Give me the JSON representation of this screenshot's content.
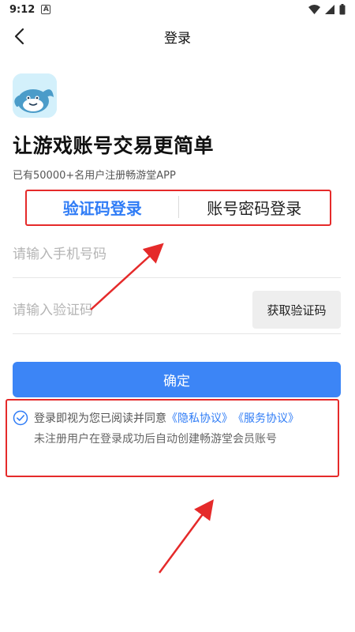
{
  "status_bar": {
    "time": "9:12",
    "notification": "A"
  },
  "nav": {
    "title": "登录"
  },
  "headline": "让游戏账号交易更简单",
  "subtext": "已有50000+名用户注册畅游堂APP",
  "tabs": {
    "sms_login": "验证码登录",
    "password_login": "账号密码登录"
  },
  "form": {
    "phone_placeholder": "请输入手机号码",
    "code_placeholder": "请输入验证码",
    "get_code_label": "获取验证码",
    "confirm_label": "确定"
  },
  "agreement": {
    "prefix": "登录即视为您已阅读并同意",
    "privacy_link": "《隐私协议》",
    "service_link": "《服务协议》",
    "note": "未注册用户在登录成功后自动创建畅游堂会员账号"
  },
  "colors": {
    "accent": "#2f7cf6",
    "button": "#3c85f6",
    "annotation": "#e52a2a"
  }
}
